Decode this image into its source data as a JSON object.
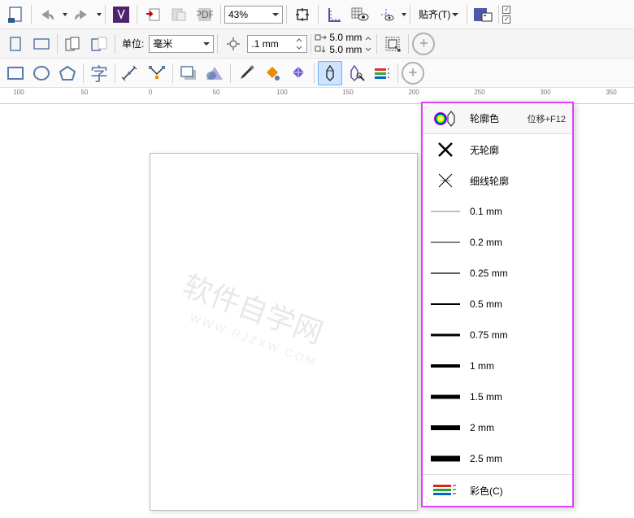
{
  "toolbar1": {
    "zoom_value": "43%",
    "align_label": "贴齐(T)"
  },
  "toolbar2": {
    "units_label": "单位:",
    "units_value": "毫米",
    "nudge_value": ".1 mm",
    "dup_x": "5.0 mm",
    "dup_y": "5.0 mm"
  },
  "ruler_ticks": [
    "100",
    "50",
    "0",
    "50",
    "100",
    "150",
    "200",
    "250",
    "300",
    "350"
  ],
  "watermark1": "软件自学网",
  "watermark2": "WWW.RJZXW.COM",
  "flyout": {
    "header_label": "轮廓色",
    "header_shortcut": "位移+F12",
    "no_outline": "无轮廓",
    "hairline": "细线轮廓",
    "widths": [
      "0.1 mm",
      "0.2 mm",
      "0.25 mm",
      "0.5 mm",
      "0.75 mm",
      "1 mm",
      "1.5 mm",
      "2 mm",
      "2.5 mm"
    ],
    "color_label": "彩色(C)"
  }
}
